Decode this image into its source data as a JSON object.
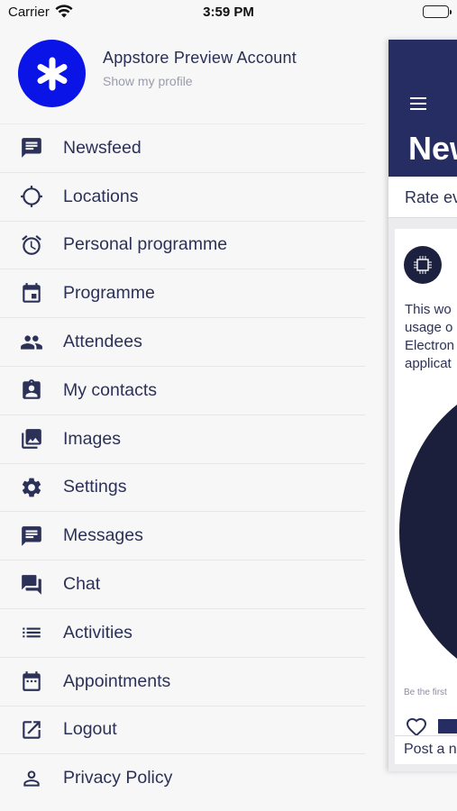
{
  "status_bar": {
    "carrier": "Carrier",
    "time": "3:59 PM"
  },
  "profile": {
    "name": "Appstore Preview Account",
    "subtitle": "Show my profile"
  },
  "menu": [
    {
      "label": "Newsfeed",
      "icon": "newsfeed-icon"
    },
    {
      "label": "Locations",
      "icon": "locations-icon"
    },
    {
      "label": "Personal programme",
      "icon": "alarm-clock-icon"
    },
    {
      "label": "Programme",
      "icon": "calendar-icon"
    },
    {
      "label": "Attendees",
      "icon": "people-icon"
    },
    {
      "label": "My contacts",
      "icon": "contact-card-icon"
    },
    {
      "label": "Images",
      "icon": "images-icon"
    },
    {
      "label": "Settings",
      "icon": "gear-icon"
    },
    {
      "label": "Messages",
      "icon": "message-icon"
    },
    {
      "label": "Chat",
      "icon": "chat-icon"
    },
    {
      "label": "Activities",
      "icon": "list-icon"
    },
    {
      "label": "Appointments",
      "icon": "calendar-grid-icon"
    },
    {
      "label": "Logout",
      "icon": "logout-icon"
    },
    {
      "label": "Privacy Policy",
      "icon": "person-icon"
    }
  ],
  "panel": {
    "title": "New",
    "rate": "Rate ev",
    "card_text": [
      "This wo",
      "usage o",
      "Electron",
      "applicat"
    ],
    "first_text": "Be the first",
    "post_placeholder": "Post a n"
  },
  "colors": {
    "accent": "#262d63",
    "avatar": "#0a14e6",
    "text": "#2b3157"
  }
}
